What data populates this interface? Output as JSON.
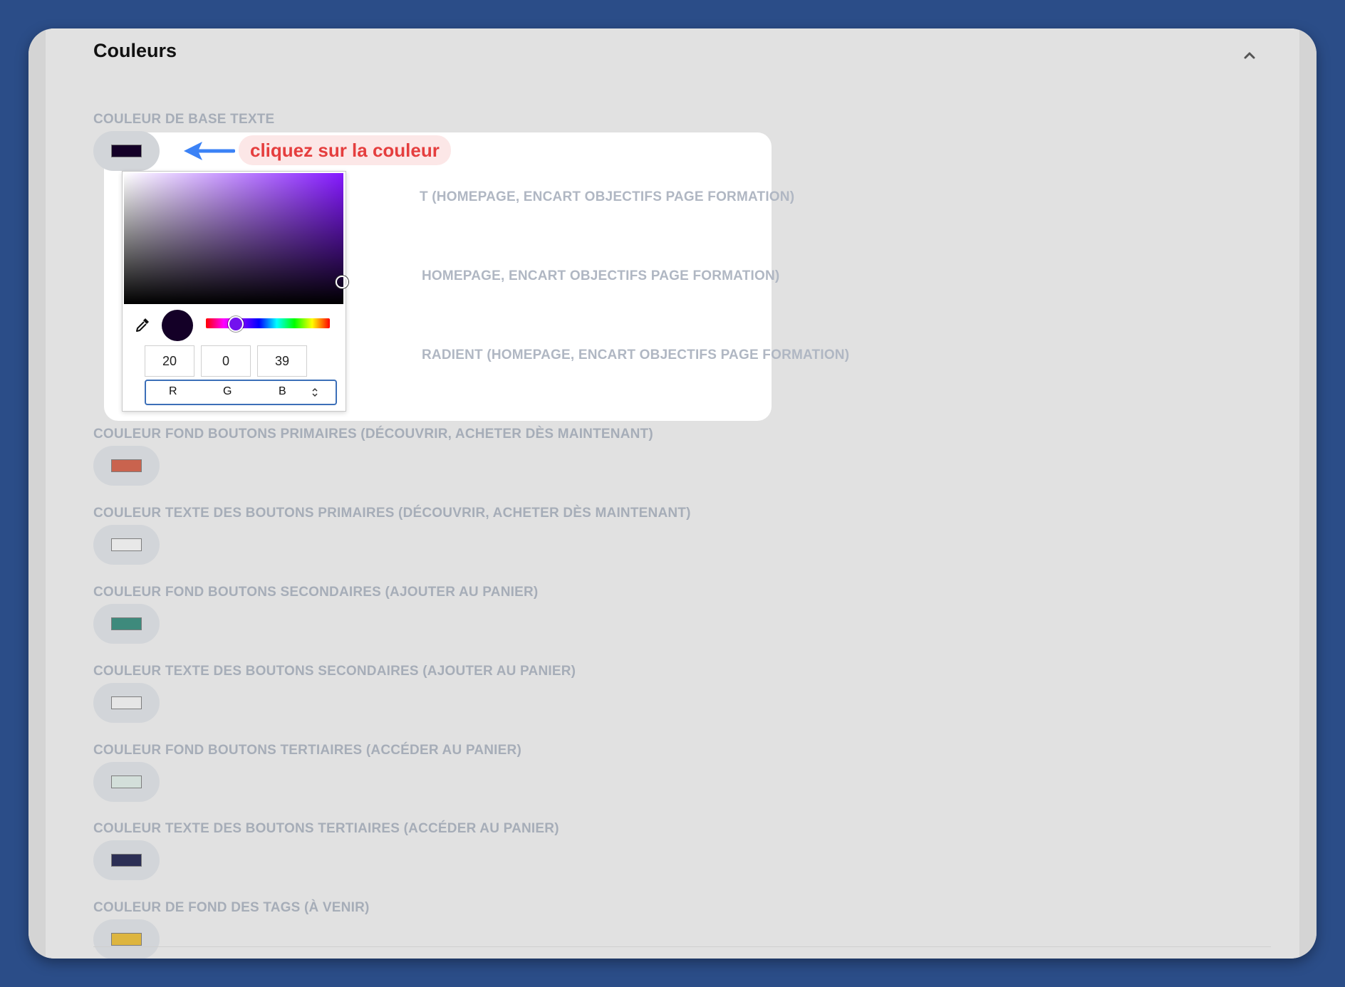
{
  "section": {
    "title": "Couleurs"
  },
  "callout": {
    "text": "cliquez sur la couleur"
  },
  "fields": [
    {
      "label": "COULEUR DE BASE TEXTE",
      "color": "#140027"
    },
    {
      "label": "T (HOMEPAGE, ENCART OBJECTIFS PAGE FORMATION)"
    },
    {
      "label": "HOMEPAGE, ENCART OBJECTIFS PAGE FORMATION)"
    },
    {
      "label": "RADIENT (HOMEPAGE, ENCART OBJECTIFS PAGE FORMATION)"
    },
    {
      "label": "COULEUR FOND BOUTONS PRIMAIRES (DÉCOUVRIR, ACHETER DÈS MAINTENANT)",
      "color": "#c9634e"
    },
    {
      "label": "COULEUR TEXTE DES BOUTONS PRIMAIRES (DÉCOUVRIR, ACHETER DÈS MAINTENANT)",
      "color": "#e8e8e8"
    },
    {
      "label": "COULEUR FOND BOUTONS SECONDAIRES (AJOUTER AU PANIER)",
      "color": "#3e8a7c"
    },
    {
      "label": "COULEUR TEXTE DES BOUTONS SECONDAIRES (AJOUTER AU PANIER)",
      "color": "#e6e6e6"
    },
    {
      "label": "COULEUR FOND BOUTONS TERTIAIRES (ACCÉDER AU PANIER)",
      "color": "#d3dfda"
    },
    {
      "label": "COULEUR TEXTE DES BOUTONS TERTIAIRES (ACCÉDER AU PANIER)",
      "color": "#2c2f55"
    },
    {
      "label": "COULEUR DE FOND DES TAGS (À VENIR)",
      "color": "#ddb53f"
    }
  ],
  "picker": {
    "r": "20",
    "g": "0",
    "b": "39",
    "mode_r": "R",
    "mode_g": "G",
    "mode_b": "B",
    "preview_color": "#140027",
    "hue_color": "#8419ff"
  }
}
